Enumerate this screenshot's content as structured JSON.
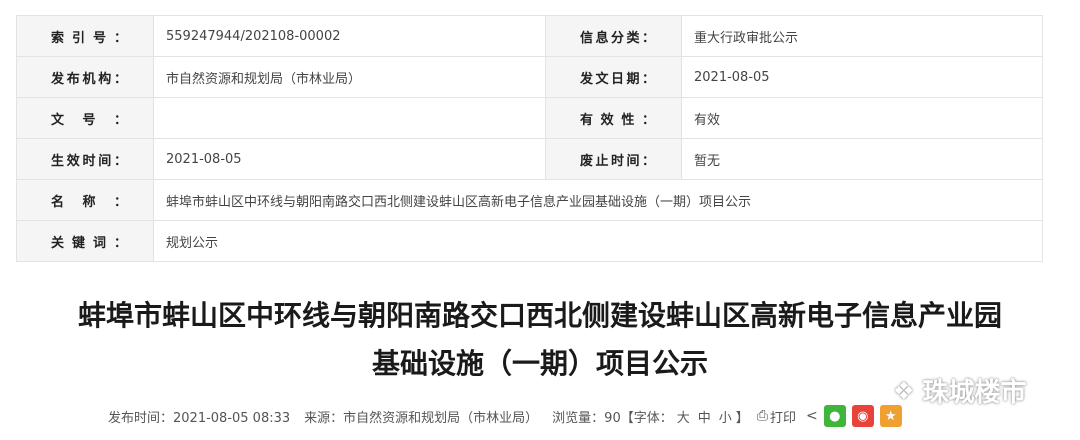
{
  "info": {
    "rows": [
      {
        "label1": "索引号：",
        "value1": "559247944/202108-00002",
        "label2": "信息分类：",
        "value2": "重大行政审批公示"
      },
      {
        "label1": "发布机构：",
        "value1": "市自然资源和规划局（市林业局）",
        "label2": "发文日期：",
        "value2": "2021-08-05"
      },
      {
        "label1": "文号：",
        "value1": "",
        "label2": "有效性：",
        "value2": "有效"
      },
      {
        "label1": "生效时间：",
        "value1": "2021-08-05",
        "label2": "废止时间：",
        "value2": "暂无"
      }
    ],
    "name_label": "名称：",
    "name_value": "蚌埠市蚌山区中环线与朝阳南路交口西北侧建设蚌山区高新电子信息产业园基础设施（一期）项目公示",
    "keywords_label": "关键词：",
    "keywords_value": "规划公示"
  },
  "article": {
    "title_line1": "蚌埠市蚌山区中环线与朝阳南路交口西北侧建设蚌山区高新电子信息产业园",
    "title_line2": "基础设施（一期）项目公示"
  },
  "meta": {
    "publish_time": "发布时间：2021-08-05 08:33",
    "source": "来源：市自然资源和规划局（市林业局）",
    "views": "浏览量：90",
    "font_prefix": "【字体：",
    "size_large": "大",
    "size_medium": "中",
    "size_small": "小",
    "font_suffix": "】",
    "print_label": "打印"
  },
  "watermark": {
    "text": "珠城楼市"
  }
}
